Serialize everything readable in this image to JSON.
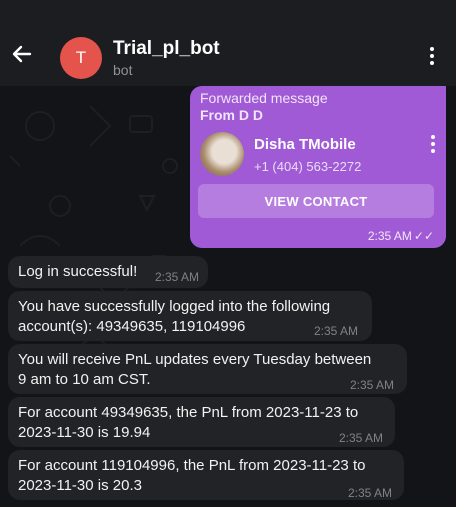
{
  "header": {
    "title": "Trial_pl_bot",
    "subtitle": "bot",
    "avatar_letter": "T",
    "avatar_color": "#e4534c"
  },
  "forwarded": {
    "label": "Forwarded message",
    "from": "From D D",
    "contact_name": "Disha TMobile",
    "contact_phone": "+1 (404) 563-2272",
    "button_label": "VIEW CONTACT",
    "time": "2:35 AM",
    "status": "read",
    "bubble_color": "#a05ad6"
  },
  "messages": [
    {
      "lines": [
        "Log in successful!"
      ],
      "time": "2:35 AM"
    },
    {
      "lines": [
        "You have successfully logged into the following",
        "account(s): 49349635, 119104996"
      ],
      "time": "2:35 AM"
    },
    {
      "lines": [
        "You will receive PnL updates every Tuesday between",
        "9 am to 10 am CST."
      ],
      "time": "2:35 AM"
    },
    {
      "lines": [
        "For account 49349635, the PnL from 2023-11-23 to",
        "2023-11-30 is 19.94"
      ],
      "time": "2:35 AM"
    },
    {
      "lines": [
        "For account 119104996, the PnL from 2023-11-23 to",
        "2023-11-30 is 20.3"
      ],
      "time": "2:35 AM"
    }
  ]
}
